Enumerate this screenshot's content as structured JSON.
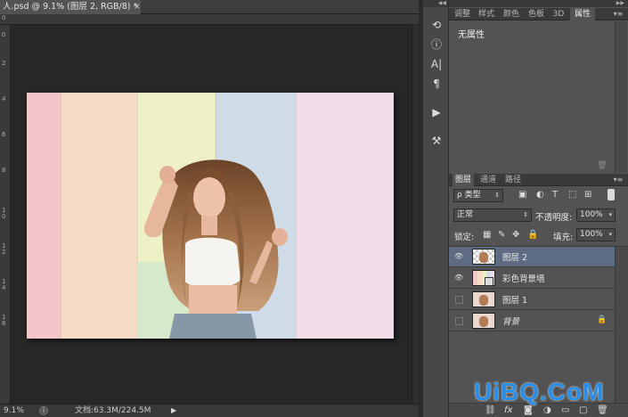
{
  "document": {
    "tab_title": "人.psd @ 9.1% (图层 2, RGB/8) *",
    "close_glyph": "×"
  },
  "rulers": {
    "top": [
      "0"
    ],
    "left": [
      "0",
      "2",
      "4",
      "6",
      "8",
      "1\n0",
      "1\n2",
      "1\n4",
      "1\n6"
    ]
  },
  "status": {
    "zoom": "9.1%",
    "doc_info": "文档:63.3M/224.5M"
  },
  "properties_panel": {
    "tabs": [
      "调整",
      "样式",
      "颜色",
      "色板",
      "3D",
      "属性"
    ],
    "active_tab": "属性",
    "content": "无属性"
  },
  "layers_panel": {
    "tabs": [
      "图层",
      "通道",
      "路径"
    ],
    "active_tab": "图层",
    "filter_label": "ρ 类型",
    "blend_mode": "正常",
    "opacity_label": "不透明度:",
    "opacity_value": "100%",
    "lock_label": "锁定:",
    "fill_label": "填充:",
    "fill_value": "100%",
    "layers": [
      {
        "name": "图层 2",
        "visible": true,
        "selected": true
      },
      {
        "name": "彩色背景墙",
        "visible": true,
        "selected": false
      },
      {
        "name": "图层 1",
        "visible": false,
        "selected": false
      },
      {
        "name": "背景",
        "visible": false,
        "selected": false,
        "locked": true
      }
    ],
    "footer_icons": [
      "link-icon",
      "fx-icon",
      "mask-icon",
      "adjustment-icon",
      "group-icon",
      "new-layer-icon",
      "trash-icon"
    ]
  },
  "watermark": "UiBQ.CoM",
  "colors": {
    "selected_layer": "#5d6c82",
    "panel_bg": "#535353",
    "watermark": "#2a8ee6"
  }
}
